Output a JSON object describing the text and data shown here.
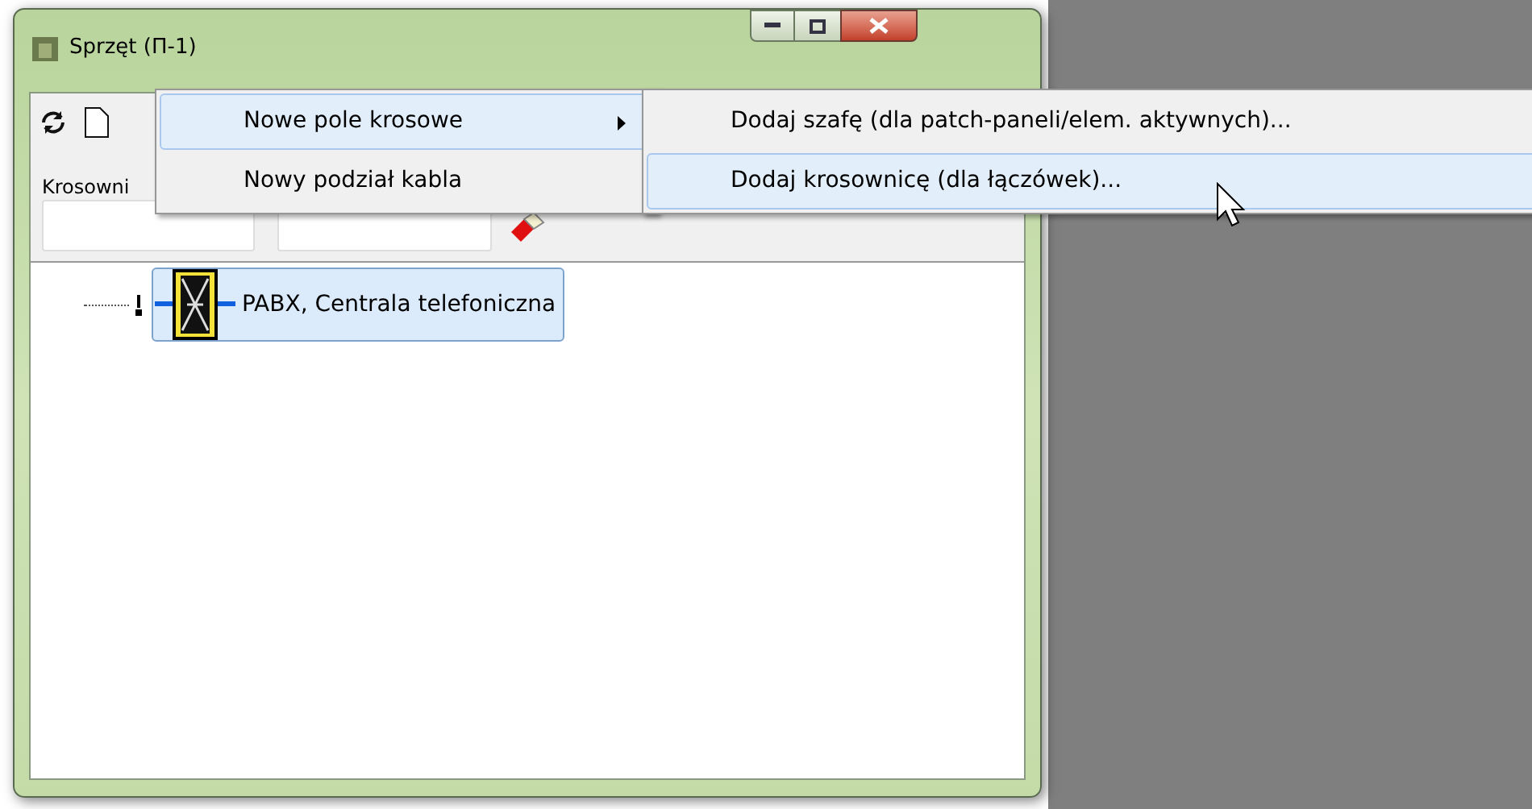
{
  "window": {
    "title": "Sprzęt (П-1)"
  },
  "toolbar": {
    "label": "Krosowni"
  },
  "tree": {
    "items": [
      {
        "label": "PABX, Centrala telefoniczna",
        "selected": true
      }
    ]
  },
  "context_menu": {
    "items": [
      {
        "label": "Nowe pole krosowe",
        "selected": true,
        "submenu": true
      },
      {
        "label": "Nowy podział kabla",
        "selected": false,
        "submenu": false
      }
    ]
  },
  "submenu": {
    "items": [
      {
        "label": "Dodaj szafę (dla patch-paneli/elem. aktywnych)...",
        "selected": false
      },
      {
        "label": "Dodaj krosownicę (dla łączówek)...",
        "selected": true
      }
    ]
  }
}
